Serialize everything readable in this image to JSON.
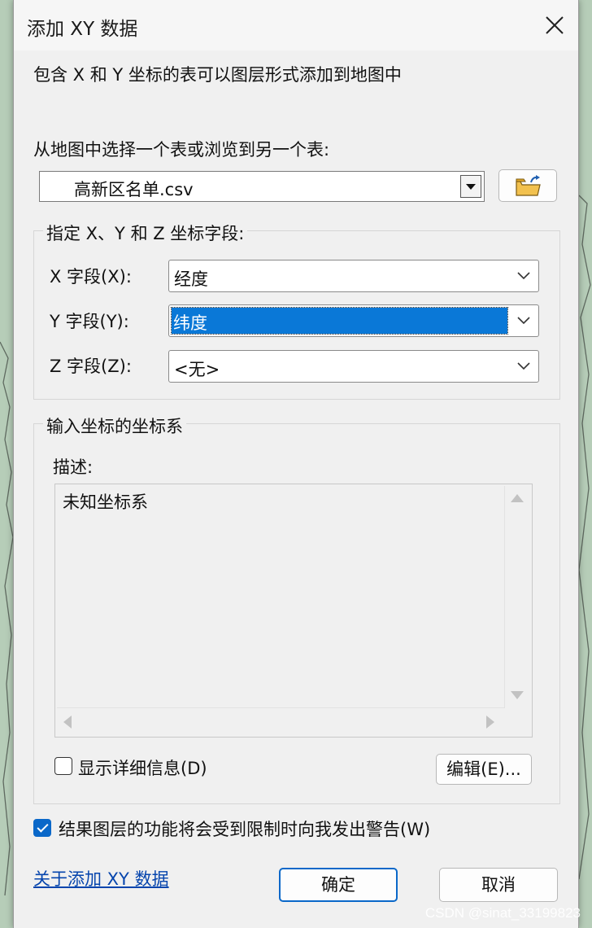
{
  "window": {
    "title": "添加 XY 数据"
  },
  "intro_text": "包含 X 和 Y 坐标的表可以图层形式添加到地图中",
  "table_select": {
    "label": "从地图中选择一个表或浏览到另一个表:",
    "value": "高新区名单.csv"
  },
  "fields_group": {
    "title": "指定 X、Y 和 Z 坐标字段:",
    "x": {
      "label": "X 字段(X):",
      "value": "经度"
    },
    "y": {
      "label": "Y 字段(Y):",
      "value": "纬度"
    },
    "z": {
      "label": "Z 字段(Z):",
      "value": "<无>"
    }
  },
  "crs_group": {
    "title": "输入坐标的坐标系",
    "desc_label": "描述:",
    "desc_text": "未知坐标系",
    "show_details_label": "显示详细信息(D)",
    "edit_button": "编辑(E)..."
  },
  "warn_checkbox": {
    "label": "结果图层的功能将会受到限制时向我发出警告(W)",
    "checked": true
  },
  "about_link": "关于添加 XY 数据",
  "buttons": {
    "ok": "确定",
    "cancel": "取消"
  },
  "watermark": "CSDN @sinat_33199823",
  "colors": {
    "accent": "#0a68c9",
    "selection": "#0a78d7",
    "link": "#0645ad",
    "map_bg": "#b6cdb8"
  }
}
